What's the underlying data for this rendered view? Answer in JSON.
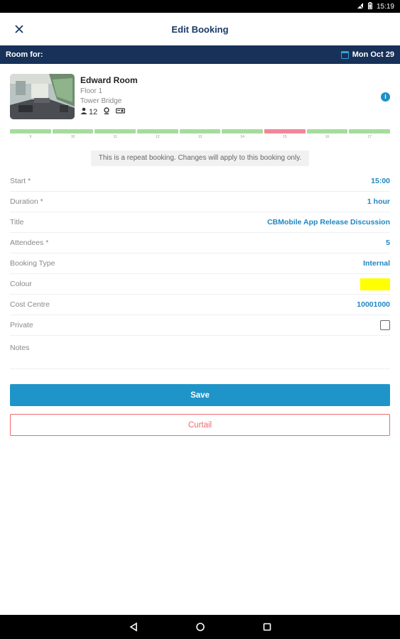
{
  "status_bar": {
    "time": "15:19"
  },
  "header": {
    "title": "Edit Booking"
  },
  "subheader": {
    "room_for_label": "Room for:",
    "date": "Mon Oct 29"
  },
  "room": {
    "name": "Edward Room",
    "floor": "Floor 1",
    "building": "Tower Bridge",
    "capacity": "12"
  },
  "timeline": {
    "hours": [
      "9",
      "10",
      "11",
      "12",
      "13",
      "14",
      "15",
      "16",
      "17"
    ],
    "slot_states": [
      "free",
      "free",
      "free",
      "free",
      "free",
      "free",
      "booked",
      "free",
      "free"
    ],
    "colors": {
      "free": "#a6dc9c",
      "booked": "#f2869a"
    }
  },
  "notice": "This is a repeat booking. Changes will apply to this booking only.",
  "form": {
    "start": {
      "label": "Start *",
      "value": "15:00"
    },
    "duration": {
      "label": "Duration *",
      "value": "1 hour"
    },
    "title": {
      "label": "Title",
      "value": "CBMobile App Release Discussion"
    },
    "attendees": {
      "label": "Attendees *",
      "value": "5"
    },
    "booking_type": {
      "label": "Booking Type",
      "value": "Internal"
    },
    "colour": {
      "label": "Colour",
      "value": "#ffff00"
    },
    "cost_centre": {
      "label": "Cost Centre",
      "value": "10001000"
    },
    "private": {
      "label": "Private",
      "checked": false
    },
    "notes": {
      "label": "Notes"
    }
  },
  "buttons": {
    "save": "Save",
    "curtail": "Curtail"
  },
  "colors": {
    "primary": "#1f94c9",
    "header_dark": "#173159",
    "danger": "#ef6a6f"
  }
}
